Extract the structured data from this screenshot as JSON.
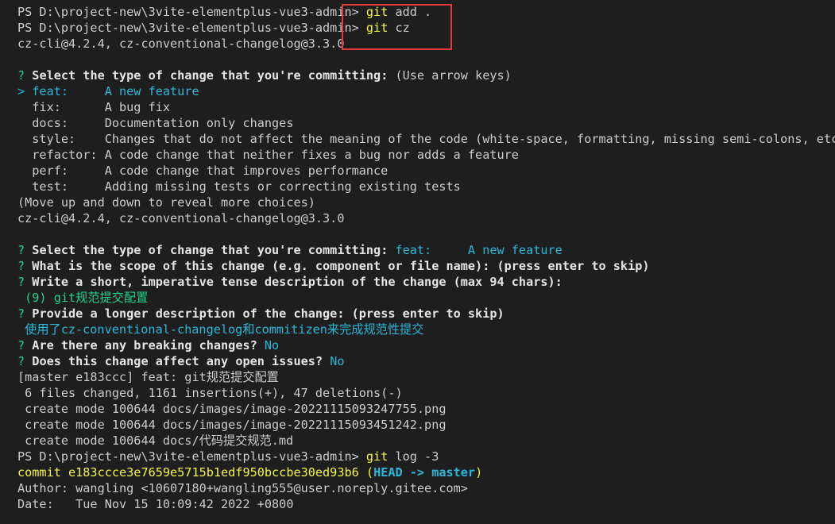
{
  "colors": {
    "background": "#1e1e1e",
    "text": "#cccccc",
    "prompt_mark": "#23d18b",
    "selected": "#29b8db",
    "command": "#f5f543",
    "highlight_box": "#e03a3a"
  },
  "l1": {
    "prompt": "PS D:\\project-new\\3vite-elementplus-vue3-admin> ",
    "cmd": "git",
    "args": " add ."
  },
  "l2": {
    "prompt": "PS D:\\project-new\\3vite-elementplus-vue3-admin> ",
    "cmd": "git",
    "args": " cz"
  },
  "l3": {
    "text": "cz-cli@4.2.4, cz-conventional-changelog@3.3.0"
  },
  "l5": {
    "mark": "? ",
    "question": "Select the type of change that you're committing: ",
    "hint": "(Use arrow keys)"
  },
  "l6": {
    "text": "> feat:     A new feature"
  },
  "l7": {
    "text": "  fix:      A bug fix"
  },
  "l8": {
    "text": "  docs:     Documentation only changes"
  },
  "l9": {
    "text": "  style:    Changes that do not affect the meaning of the code (white-space, formatting, missing semi-colons, etc)"
  },
  "l10": {
    "text": "  refactor: A code change that neither fixes a bug nor adds a feature"
  },
  "l11": {
    "text": "  perf:     A code change that improves performance"
  },
  "l12": {
    "text": "  test:     Adding missing tests or correcting existing tests"
  },
  "l13": {
    "text": "(Move up and down to reveal more choices)"
  },
  "l14": {
    "text": "cz-cli@4.2.4, cz-conventional-changelog@3.3.0"
  },
  "l16": {
    "mark": "? ",
    "question": "Select the type of change that you're committing: ",
    "answer": "feat:     A new feature"
  },
  "l17": {
    "mark": "? ",
    "question": "What is the scope of this change (e.g. component or file name): (press enter to skip)"
  },
  "l18": {
    "mark": "? ",
    "question": "Write a short, imperative tense description of the change (max 94 chars):"
  },
  "l19": {
    "text": " (9) git规范提交配置"
  },
  "l20": {
    "mark": "? ",
    "question": "Provide a longer description of the change: (press enter to skip)"
  },
  "l21": {
    "text": " 使用了cz-conventional-changelog和commitizen来完成规范性提交"
  },
  "l22": {
    "mark": "? ",
    "question": "Are there any breaking changes? ",
    "answer": "No"
  },
  "l23": {
    "mark": "? ",
    "question": "Does this change affect any open issues? ",
    "answer": "No"
  },
  "l24": {
    "text": "[master e183ccc] feat: git规范提交配置"
  },
  "l25": {
    "text": " 6 files changed, 1161 insertions(+), 47 deletions(-)"
  },
  "l26": {
    "text": " create mode 100644 docs/images/image-20221115093247755.png"
  },
  "l27": {
    "text": " create mode 100644 docs/images/image-20221115093451242.png"
  },
  "l28": {
    "text": " create mode 100644 docs/代码提交规范.md"
  },
  "l29": {
    "prompt": "PS D:\\project-new\\3vite-elementplus-vue3-admin> ",
    "cmd": "git",
    "args": " log -3"
  },
  "l30": {
    "commit": "commit e183ccce3e7659e5715b1edf950bccbe30ed93b6 ",
    "ref_open": "(",
    "head": "HEAD -> master",
    "ref_close": ")"
  },
  "l31": {
    "text": "Author: wangling <10607180+wangling555@user.noreply.gitee.com>"
  },
  "l32": {
    "text": "Date:   Tue Nov 15 10:09:42 2022 +0800"
  }
}
